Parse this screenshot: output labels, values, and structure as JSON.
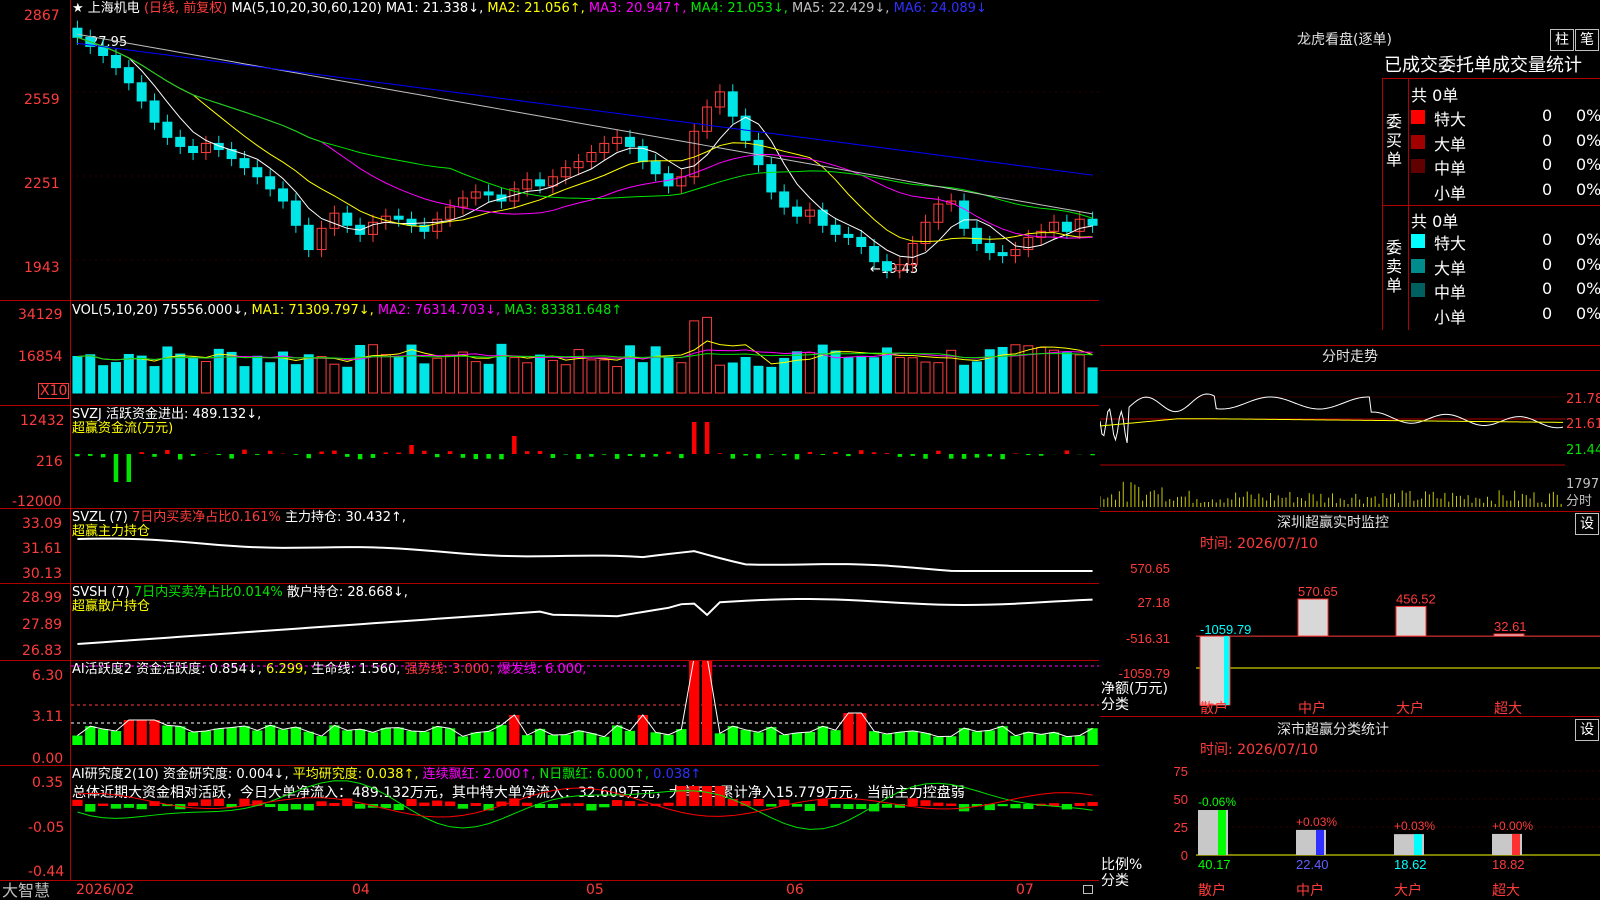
{
  "colors": {
    "up": "#ff3c3c",
    "down": "#00e6e6",
    "grid": "#b00000",
    "ma1": "#ffffff",
    "ma2": "#ffff00",
    "ma3": "#ff00ff",
    "ma4": "#00e600",
    "ma5": "#c0c0c0",
    "ma6": "#0000ff"
  },
  "price_panel": {
    "star": "★",
    "stock_name": "上海机电",
    "mode": "(日线, 前复权)",
    "ma_params": "MA(5,10,20,30,60,120)",
    "ma1": "MA1: 21.338↓,",
    "ma2": "MA2: 21.056↑,",
    "ma3": "MA3: 20.947↑,",
    "ma4": "MA4: 21.053↓,",
    "ma5": "MA5: 22.429↓,",
    "ma6": "MA6: 24.089↓",
    "high_label": "27.95",
    "low_label": "←19.43",
    "y_ticks": [
      "2867",
      "2559",
      "2251",
      "1943"
    ]
  },
  "vol_panel": {
    "label": "VOL(5,10,20)",
    "value": "75556.000↓,",
    "ma1": "MA1: 71309.797↓,",
    "ma2": "MA2: 76314.703↓,",
    "ma3": "MA3: 83381.648↑",
    "y_ticks": [
      "34129",
      "16854"
    ],
    "unit": "X10"
  },
  "svzj_panel": {
    "label": "SVZJ  活跃资金进出: 489.132↓,",
    "sub": "超赢资金流(万元)",
    "y_ticks": [
      "12432",
      "216",
      "-12000"
    ]
  },
  "svzl_panel": {
    "label": "SVZL (7)",
    "ratio": "7日内买卖净占比0.161%",
    "hold": "主力持仓: 30.432↑,",
    "sub": "超赢主力持仓",
    "y_ticks": [
      "33.09",
      "31.61",
      "30.13"
    ]
  },
  "svsh_panel": {
    "label": "SVSH (7)",
    "ratio": "7日内买卖净占比0.014%",
    "hold": "散户持仓: 28.668↓,",
    "sub": "超赢散户持仓",
    "y_ticks": [
      "28.99",
      "27.89",
      "26.83"
    ]
  },
  "ai_active_panel": {
    "label": "AI活跃度2",
    "active": "资金活跃度: 0.854↓,",
    "v2": "6.299,",
    "life": "生命线: 1.560,",
    "strong": "强势线: 3.000,",
    "burst": "爆发线: 6.000,",
    "y_ticks": [
      "6.30",
      "3.11",
      "0.00"
    ]
  },
  "ai_research_panel": {
    "label": "AI研究度2(10)",
    "research": "资金研究度: 0.004↓,",
    "avg": "平均研究度: 0.038↑,",
    "red": "连续飘红: 2.000↑,",
    "nred": "N日飘红: 6.000↑,",
    "last": "0.038↑",
    "comment": "总体近期大资金相对活跃，今日大单净流入：489.132万元，其中特大单净流入：32.609万元，大单5日累计净入15.779万元，当前主力控盘弱",
    "y_ticks": [
      "0.35",
      "-0.05",
      "-0.44"
    ]
  },
  "x_axis": {
    "brand": "大智慧",
    "labels": [
      "2026/02",
      "04",
      "05",
      "06",
      "07"
    ]
  },
  "dragon": {
    "title": "龙虎看盘(逐单)",
    "btn1": "柱",
    "btn2": "笔",
    "header": "已成交委托单成交量统计",
    "buy_label": "委买单",
    "buy_total": "共 0单",
    "sell_label": "委卖单",
    "sell_total": "共 0单",
    "buy_rows": [
      {
        "name": "特大",
        "n": "0",
        "p": "0%",
        "color": "#ff0000"
      },
      {
        "name": "大单",
        "n": "0",
        "p": "0%",
        "color": "#a00000"
      },
      {
        "name": "中单",
        "n": "0",
        "p": "0%",
        "color": "#600000"
      },
      {
        "name": "小单",
        "n": "0",
        "p": "0%",
        "color": "none"
      }
    ],
    "sell_rows": [
      {
        "name": "特大",
        "n": "0",
        "p": "0%",
        "color": "#00ffff"
      },
      {
        "name": "大单",
        "n": "0",
        "p": "0%",
        "color": "#008c8c"
      },
      {
        "name": "中单",
        "n": "0",
        "p": "0%",
        "color": "#006060"
      },
      {
        "name": "小单",
        "n": "0",
        "p": "0%",
        "color": "none"
      }
    ]
  },
  "minute": {
    "title": "分时走势",
    "y_ticks": [
      "21.78",
      "21.61",
      "21.44"
    ],
    "vol_tick": "1797",
    "vol_label": "分时"
  },
  "sz_monitor": {
    "title": "深圳超赢实时监控",
    "btn": "设",
    "time": "时间: 2026/07/10",
    "y_ticks": [
      "570.65",
      "27.18",
      "-516.31",
      "-1059.79"
    ],
    "ylabel": "净额(万元)",
    "xlabel": "分类",
    "cats": [
      "散户",
      "中户",
      "大户",
      "超大"
    ],
    "values": [
      -1059.79,
      570.65,
      456.52,
      32.61
    ],
    "value_labels": [
      "-1059.79",
      "570.65",
      "456.52",
      "32.61"
    ]
  },
  "sz_stats": {
    "title": "深市超赢分类统计",
    "btn": "设",
    "time": "时间: 2026/07/10",
    "y_ticks": [
      "75",
      "50",
      "25",
      "0"
    ],
    "ylabel": "比例%",
    "xlabel": "分类",
    "cats": [
      "散户",
      "中户",
      "大户",
      "超大"
    ],
    "values": [
      40.17,
      22.4,
      18.62,
      18.82
    ],
    "deltas": [
      "-0.06%",
      "+0.03%",
      "+0.03%",
      "+0.00%"
    ],
    "colors": [
      "#00ff00",
      "#3030ff",
      "#00ffff",
      "#ff3030"
    ]
  },
  "chart_data": [
    {
      "type": "candlestick",
      "title": "上海机电 (日线, 前复权)",
      "y_ticks": [
        "2867",
        "2559",
        "2251",
        "1943"
      ],
      "high": 27.95,
      "low": 19.43,
      "closes": [
        27.4,
        27.1,
        26.8,
        26.4,
        25.9,
        25.3,
        24.6,
        24.1,
        23.8,
        23.6,
        23.9,
        23.7,
        23.4,
        23.1,
        22.8,
        22.4,
        22.0,
        21.2,
        20.4,
        21.1,
        21.6,
        21.2,
        20.9,
        21.3,
        21.5,
        21.4,
        21.2,
        21.0,
        21.4,
        21.8,
        22.1,
        22.3,
        22.2,
        22.0,
        22.4,
        22.7,
        22.5,
        22.8,
        23.1,
        23.3,
        23.6,
        23.9,
        24.1,
        23.8,
        23.3,
        22.9,
        22.5,
        22.8,
        24.3,
        25.1,
        25.6,
        24.8,
        24.0,
        23.2,
        22.3,
        21.8,
        21.5,
        21.7,
        21.2,
        20.9,
        20.8,
        20.5,
        20.0,
        19.7,
        19.9,
        20.6,
        21.3,
        21.9,
        22.0,
        21.1,
        20.6,
        20.3,
        20.2,
        20.4,
        20.8,
        21.0,
        21.3,
        21.0,
        21.4,
        21.2
      ]
    },
    {
      "type": "bar",
      "title": "VOL(5,10,20)",
      "values": [
        75556
      ]
    },
    {
      "type": "bar",
      "title": "深圳超赢实时监控",
      "categories": [
        "散户",
        "中户",
        "大户",
        "超大"
      ],
      "values": [
        -1059.79,
        570.65,
        456.52,
        32.61
      ],
      "ylabel": "净额(万元)",
      "xlabel": "分类"
    },
    {
      "type": "bar",
      "title": "深市超赢分类统计",
      "categories": [
        "散户",
        "中户",
        "大户",
        "超大"
      ],
      "values": [
        40.17,
        22.4,
        18.62,
        18.82
      ],
      "ylabel": "比例%",
      "xlabel": "分类",
      "ylim": [
        0,
        75
      ]
    }
  ]
}
